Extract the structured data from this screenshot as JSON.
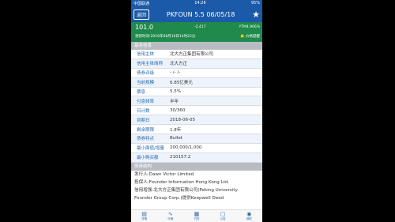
{
  "status": {
    "carrier": "中国联通",
    "network": "令",
    "time": "14:26",
    "battery": "95%"
  },
  "header": {
    "back_label": "返回",
    "title": "PKFOUN 5.5 06/05/18",
    "favorite_icon": "star-icon"
  },
  "quote": {
    "price": "101.0",
    "change": "-2.417",
    "ytm": "YTM4.906%",
    "updated": "更新时间:2016年08月16日14时22分",
    "alert": "价格提醒"
  },
  "basic_info": {
    "section_title": "基本信息",
    "rows": [
      {
        "label": "信用主体",
        "value": "北大方正集团有限公司"
      },
      {
        "label": "信用主体简称",
        "value": "北大方正"
      },
      {
        "label": "债券评级",
        "value": "- /- /-"
      },
      {
        "label": "当前规模",
        "value": "6.85亿美元"
      },
      {
        "label": "票息",
        "value": "5.5%"
      },
      {
        "label": "付息频率",
        "value": "半年"
      },
      {
        "label": "日计数",
        "value": "30/360"
      },
      {
        "label": "到期日",
        "value": "2018-06-05"
      },
      {
        "label": "剩余期限",
        "value": "1.8年"
      },
      {
        "label": "债券特点",
        "value": "Bullet"
      },
      {
        "label": "最小面值/增量",
        "value": "200,000/1,000"
      },
      {
        "label": "最小购买额",
        "value": "210157.2"
      }
    ]
  },
  "structure": {
    "section_title": "债券结构",
    "issuer": "发行人:Dawn Victor Limited",
    "guarantor": "担保人:Founder Information Hong Kong Ltd.",
    "credit_support": "信用增强:北大方正集团有限公司(Peking University",
    "credit_support_cont": "Founder Group Corp.)提供Keepwell Deed"
  },
  "tabs": [
    "详情",
    "行情",
    "日历",
    "公告",
    "我的"
  ]
}
